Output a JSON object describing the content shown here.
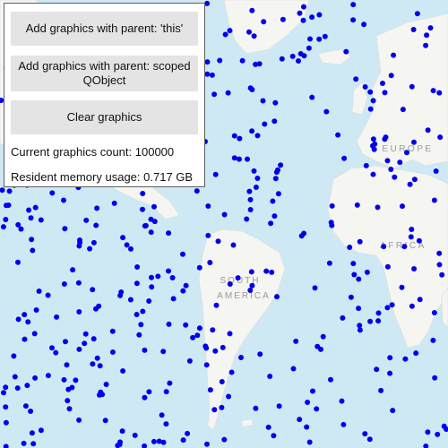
{
  "panel": {
    "btn_this": "Add graphics with parent: 'this'",
    "btn_scoped": "Add graphics with parent: scoped QObject",
    "btn_clear": "Clear graphics",
    "count_label": "Current graphics count:",
    "count_value": "100000",
    "mem_label": "Resident memory usage:",
    "mem_value": "0.717 GB"
  },
  "map": {
    "labels": {
      "europe": "EUROPE",
      "africa": "AFRICA",
      "south_america_1": "SOUTH",
      "south_america_2": "AMERICA"
    },
    "colors": {
      "ocean": "#cfe9f4",
      "land": "#f5f5f2",
      "graphic": "#0000ee"
    }
  }
}
